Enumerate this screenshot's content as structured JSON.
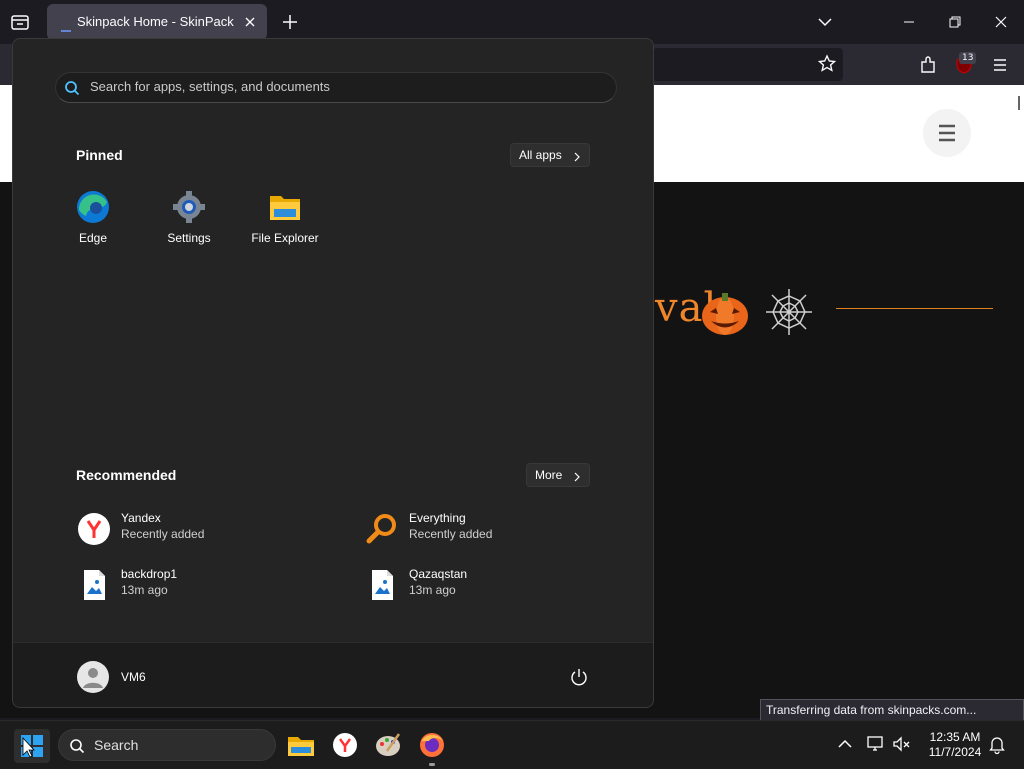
{
  "browser": {
    "tab": {
      "title": "Skinpack Home - SkinPack"
    },
    "extension_badge": "13"
  },
  "page": {
    "heading_fragment": "val",
    "status_text": "Transferring data from skinpacks.com..."
  },
  "start_menu": {
    "search_placeholder": "Search for apps, settings, and documents",
    "pinned": {
      "title": "Pinned",
      "all_apps_label": "All apps",
      "apps": [
        {
          "label": "Edge",
          "icon": "edge-icon"
        },
        {
          "label": "Settings",
          "icon": "settings-gear-icon"
        },
        {
          "label": "File Explorer",
          "icon": "folder-icon"
        }
      ]
    },
    "recommended": {
      "title": "Recommended",
      "more_label": "More",
      "items": [
        {
          "name": "Yandex",
          "sub": "Recently added",
          "icon": "yandex-icon"
        },
        {
          "name": "Everything",
          "sub": "Recently added",
          "icon": "magnifier-icon"
        },
        {
          "name": "backdrop1",
          "sub": "13m ago",
          "icon": "image-file-icon"
        },
        {
          "name": "Qazaqstan",
          "sub": "13m ago",
          "icon": "image-file-icon"
        }
      ]
    },
    "user": {
      "name": "VM6"
    }
  },
  "taskbar": {
    "search_label": "Search",
    "time": "12:35 AM",
    "date": "11/7/2024"
  },
  "colors": {
    "accent_orange": "#f0862b",
    "start_bg": "#242424",
    "taskbar_bg": "#1c1c1c"
  }
}
